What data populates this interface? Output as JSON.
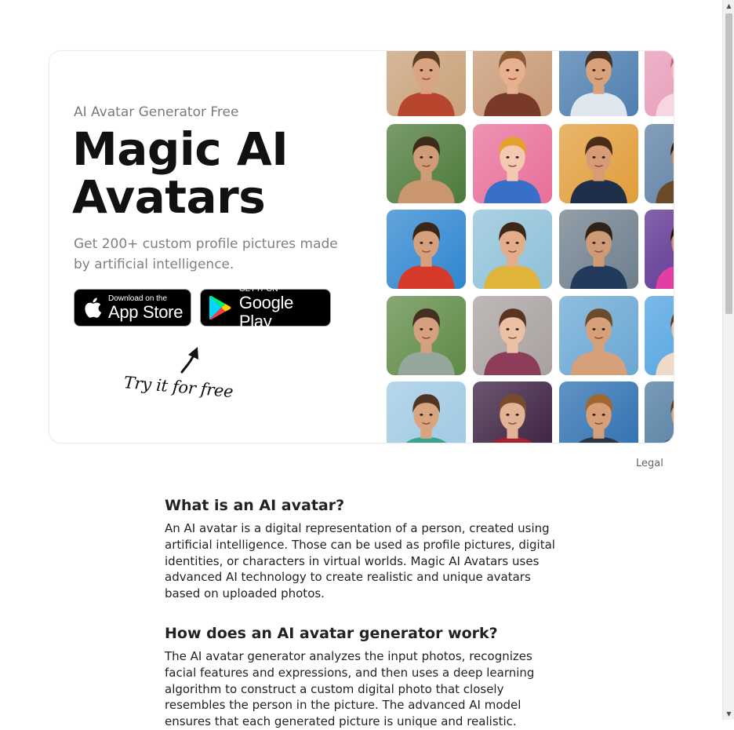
{
  "hero": {
    "eyebrow": "AI Avatar Generator Free",
    "headline": "Magic AI Avatars",
    "subheadline": "Get 200+ custom profile pictures made by artificial intelligence.",
    "app_store": {
      "small": "Download on the",
      "big": "App Store"
    },
    "google_play": {
      "small": "GET IT ON",
      "big": "Google Play"
    },
    "try_label": "Try it for free"
  },
  "gallery": {
    "tiles": [
      {
        "bg": "#c9a27a",
        "skin": "#d9a47f",
        "hair": "#5a3b24",
        "shirt": "#b8452e"
      },
      {
        "bg": "#c89a76",
        "skin": "#e6b18c",
        "hair": "#8a5a34",
        "shirt": "#7a3a2a"
      },
      {
        "bg": "#4f7fb0",
        "skin": "#d8a37c",
        "hair": "#4a3020",
        "shirt": "#dfe6ee"
      },
      {
        "bg": "#e69bb8",
        "skin": "#f0c4b0",
        "hair": "#c85e8d",
        "shirt": "#f7d6e2"
      },
      {
        "bg": "#4d7a3a",
        "skin": "#d09c78",
        "hair": "#3d2a1a",
        "shirt": "#c9966f"
      },
      {
        "bg": "#e86f9a",
        "skin": "#f3c9b1",
        "hair": "#e3a12e",
        "shirt": "#3a6fc9"
      },
      {
        "bg": "#e19d3a",
        "skin": "#d79c75",
        "hair": "#4a2c1a",
        "shirt": "#1f2f4a"
      },
      {
        "bg": "#5c7fa3",
        "skin": "#c48a63",
        "hair": "#2d1c12",
        "shirt": "#6b4a2a"
      },
      {
        "bg": "#2f86d0",
        "skin": "#d7a07c",
        "hair": "#3a2617",
        "shirt": "#d63a2a"
      },
      {
        "bg": "#8ec1d9",
        "skin": "#e3ad8a",
        "hair": "#3c2719",
        "shirt": "#e0b33a"
      },
      {
        "bg": "#6e7f8c",
        "skin": "#cf9a76",
        "hair": "#2f2219",
        "shirt": "#223a5c"
      },
      {
        "bg": "#5a2f8f",
        "skin": "#c98f6e",
        "hair": "#1f1410",
        "shirt": "#e23fa3"
      },
      {
        "bg": "#5f8a45",
        "skin": "#d4a07e",
        "hair": "#433020",
        "shirt": "#95a79a"
      },
      {
        "bg": "#a8a1a0",
        "skin": "#ebc0a3",
        "hair": "#5a3522",
        "shirt": "#8d3d5a"
      },
      {
        "bg": "#6aa7d3",
        "skin": "#d6a07a",
        "hair": "#6c4a2c",
        "shirt": "#d6a07a"
      },
      {
        "bg": "#4ea2e0",
        "skin": "#ecc2a5",
        "hair": "#5e3a22",
        "shirt": "#efd9c8"
      },
      {
        "bg": "#9fc9e3",
        "skin": "#d8a580",
        "hair": "#4f3524",
        "shirt": "#3aa38d"
      },
      {
        "bg": "#3a1f3f",
        "skin": "#e2b394",
        "hair": "#7a4a2c",
        "shirt": "#a0242e"
      },
      {
        "bg": "#2e6fb0",
        "skin": "#d79f78",
        "hair": "#a0672e",
        "shirt": "#2d3544"
      },
      {
        "bg": "#4d7a9f",
        "skin": "#d8a683",
        "hair": "#5c3d28",
        "shirt": "#2a3b52"
      }
    ]
  },
  "footer": {
    "legal": "Legal"
  },
  "article": {
    "sections": [
      {
        "heading": "What is an AI avatar?",
        "body": "An AI avatar is a digital representation of a person, created using artificial intelligence. Those can be used as profile pictures, digital identities, or characters in virtual worlds. Magic AI Avatars uses advanced AI technology to create realistic and unique avatars based on uploaded photos."
      },
      {
        "heading": "How does an AI avatar generator work?",
        "body": "The AI avatar generator analyzes the input photos, recognizes facial features and expressions, and then uses a deep learning algorithm to construct a custom digital photo that closely resembles the person in the picture. The advanced AI model ensures that each generated picture is unique and realistic."
      }
    ]
  }
}
